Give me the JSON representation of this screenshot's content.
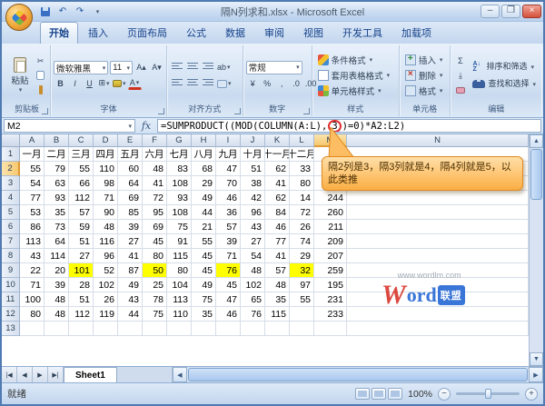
{
  "window": {
    "title": "隔N列求和.xlsx - Microsoft Excel"
  },
  "titlebar": {
    "minimize": "–",
    "maximize": "❐",
    "close": "×"
  },
  "tabs": [
    {
      "id": "home",
      "label": "开始",
      "active": true
    },
    {
      "id": "insert",
      "label": "插入"
    },
    {
      "id": "page-layout",
      "label": "页面布局"
    },
    {
      "id": "formulas",
      "label": "公式"
    },
    {
      "id": "data",
      "label": "数据"
    },
    {
      "id": "review",
      "label": "审阅"
    },
    {
      "id": "view",
      "label": "视图"
    },
    {
      "id": "developer",
      "label": "开发工具"
    },
    {
      "id": "addins",
      "label": "加载项"
    }
  ],
  "ribbon": {
    "clipboard": {
      "label": "剪贴板",
      "paste": "粘贴"
    },
    "font": {
      "label": "字体",
      "name": "微软雅黑",
      "size": "11",
      "bold": "B",
      "italic": "I",
      "underline": "U"
    },
    "alignment": {
      "label": "对齐方式"
    },
    "number": {
      "label": "数字",
      "format": "常规",
      "currency": "¥",
      "percent": "%",
      "comma": ",",
      "inc": ".0",
      "dec": ".00"
    },
    "styles": {
      "label": "样式",
      "items": [
        "条件格式",
        "套用表格格式",
        "单元格样式"
      ]
    },
    "cells": {
      "label": "单元格",
      "items": [
        "插入",
        "删除",
        "格式"
      ]
    },
    "editing": {
      "label": "编辑",
      "sum": "Σ",
      "sort": "排序和筛选",
      "find": "查找和选择"
    }
  },
  "formula_bar": {
    "name_box": "M2",
    "fx": "fx",
    "before": "=SUMPRODUCT((MOD(COLUMN(A:L),",
    "circled": "3",
    "after": ")=0)*A2:L2)"
  },
  "callout": {
    "text": "隔2列是3，隔3列就是4，隔4列就是5，以此类推"
  },
  "grid": {
    "col_letters": [
      "A",
      "B",
      "C",
      "D",
      "E",
      "F",
      "G",
      "H",
      "I",
      "J",
      "K",
      "L",
      "M",
      "N"
    ],
    "selected_col": "M",
    "selected_row": 2,
    "rows": [
      {
        "n": 1,
        "header": true,
        "cells": [
          "一月",
          "二月",
          "三月",
          "四月",
          "五月",
          "六月",
          "七月",
          "八月",
          "九月",
          "十月",
          "十一月",
          "十二月",
          "",
          ""
        ]
      },
      {
        "n": 2,
        "cells": [
          "55",
          "79",
          "55",
          "110",
          "60",
          "48",
          "83",
          "68",
          "47",
          "51",
          "62",
          "33",
          "",
          ""
        ]
      },
      {
        "n": 3,
        "cells": [
          "54",
          "63",
          "66",
          "98",
          "64",
          "41",
          "108",
          "29",
          "70",
          "38",
          "41",
          "80",
          "",
          ""
        ]
      },
      {
        "n": 4,
        "cells": [
          "77",
          "93",
          "112",
          "71",
          "69",
          "72",
          "93",
          "49",
          "46",
          "42",
          "62",
          "14",
          "244",
          ""
        ]
      },
      {
        "n": 5,
        "cells": [
          "53",
          "35",
          "57",
          "90",
          "85",
          "95",
          "108",
          "44",
          "36",
          "96",
          "84",
          "72",
          "260",
          ""
        ]
      },
      {
        "n": 6,
        "cells": [
          "86",
          "73",
          "59",
          "48",
          "39",
          "69",
          "75",
          "21",
          "57",
          "43",
          "46",
          "26",
          "211",
          ""
        ]
      },
      {
        "n": 7,
        "cells": [
          "113",
          "64",
          "51",
          "116",
          "27",
          "45",
          "91",
          "55",
          "39",
          "27",
          "77",
          "74",
          "209",
          ""
        ]
      },
      {
        "n": 8,
        "cells": [
          "43",
          "114",
          "27",
          "96",
          "41",
          "80",
          "115",
          "45",
          "71",
          "54",
          "41",
          "29",
          "207",
          ""
        ]
      },
      {
        "n": 9,
        "cells": [
          "22",
          "20",
          "101",
          "52",
          "87",
          "50",
          "80",
          "45",
          "76",
          "48",
          "57",
          "32",
          "259",
          ""
        ]
      },
      {
        "n": 10,
        "cells": [
          "71",
          "39",
          "28",
          "102",
          "49",
          "25",
          "104",
          "49",
          "45",
          "102",
          "48",
          "97",
          "195",
          ""
        ]
      },
      {
        "n": 11,
        "cells": [
          "100",
          "48",
          "51",
          "26",
          "43",
          "78",
          "113",
          "75",
          "47",
          "65",
          "35",
          "55",
          "231",
          ""
        ]
      },
      {
        "n": 12,
        "cells": [
          "80",
          "48",
          "112",
          "119",
          "44",
          "75",
          "110",
          "35",
          "46",
          "76",
          "115",
          "",
          "233",
          ""
        ]
      },
      {
        "n": 13,
        "cells": [
          "",
          "",
          "",
          "",
          "",
          "",
          "",
          "",
          "",
          "",
          "",
          "",
          "",
          ""
        ]
      }
    ],
    "highlights": {
      "9": [
        2,
        5,
        8,
        11
      ]
    }
  },
  "sheetbar": {
    "tabs": [
      "Sheet1"
    ],
    "active": "Sheet1"
  },
  "status": {
    "ready": "就绪",
    "zoom": "100%"
  },
  "watermark": {
    "site": "www.wordlm.com",
    "w": "W",
    "ord": "ord",
    "badge": "联盟"
  }
}
